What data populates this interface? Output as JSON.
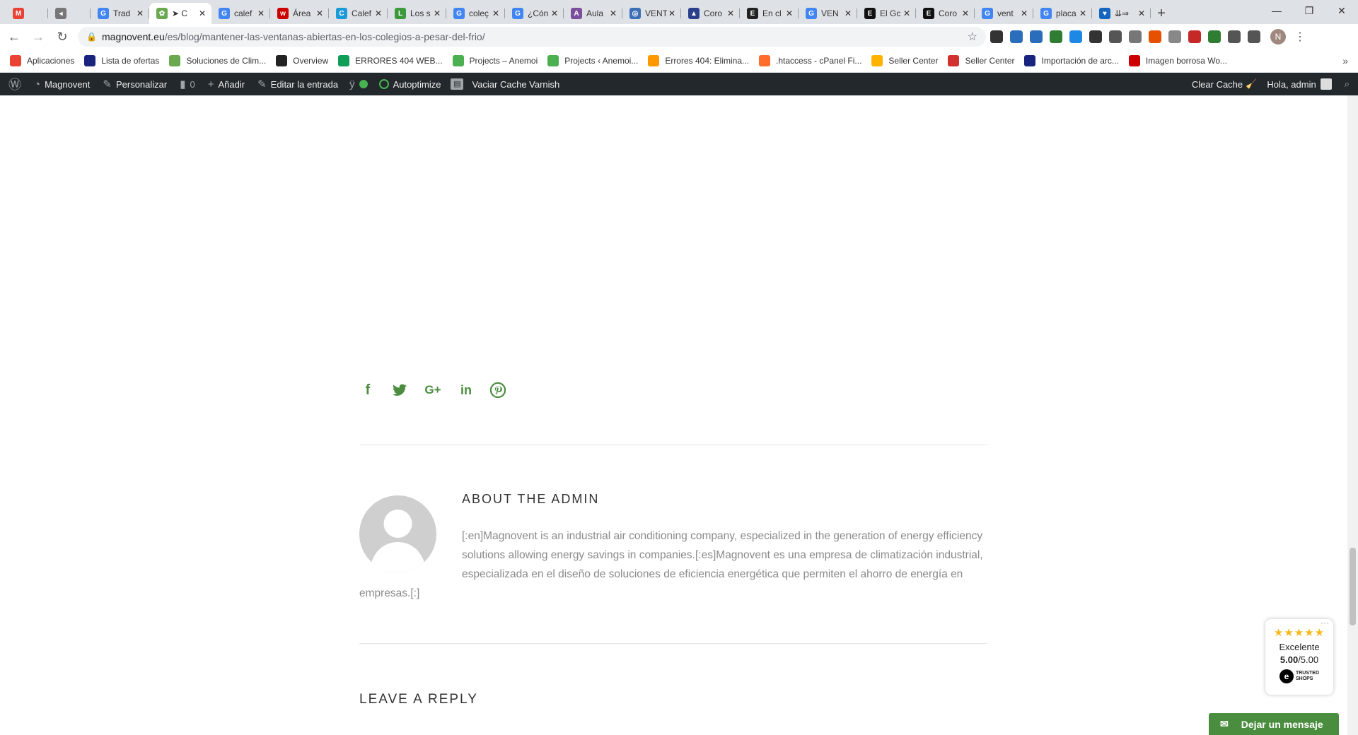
{
  "browser": {
    "tabs": [
      {
        "title": "",
        "icon": "gmail-icon",
        "color": "#ea4335",
        "letter": "M"
      },
      {
        "title": "",
        "icon": "audio-icon",
        "color": "#777777",
        "letter": "◂"
      },
      {
        "title": "Trad",
        "icon": "translate-icon",
        "color": "#4285f4",
        "letter": "G"
      },
      {
        "title": "➤ C",
        "icon": "magnovent-leaf-icon",
        "color": "#6aa84f",
        "letter": "✿",
        "active": true
      },
      {
        "title": "calef",
        "icon": "google-icon",
        "color": "#4285f4",
        "letter": "G"
      },
      {
        "title": "Área",
        "icon": "brand-w-icon",
        "color": "#cc0000",
        "letter": "w"
      },
      {
        "title": "Calef",
        "icon": "brand-c-icon",
        "color": "#1a9bd7",
        "letter": "C"
      },
      {
        "title": "Los s",
        "icon": "leaf-icon",
        "color": "#3c9a3c",
        "letter": "L"
      },
      {
        "title": "coleç",
        "icon": "google-icon",
        "color": "#4285f4",
        "letter": "G"
      },
      {
        "title": "¿Cón",
        "icon": "google-icon",
        "color": "#4285f4",
        "letter": "G"
      },
      {
        "title": "Aula",
        "icon": "aula-icon",
        "color": "#7b4f9d",
        "letter": "A"
      },
      {
        "title": "VENT",
        "icon": "globe-icon",
        "color": "#3b6fb6",
        "letter": "◎"
      },
      {
        "title": "Coro",
        "icon": "antena3-icon",
        "color": "#2b3f8c",
        "letter": "▲"
      },
      {
        "title": "En cl",
        "icon": "brand-dark-icon",
        "color": "#222222",
        "letter": "E"
      },
      {
        "title": "VEN",
        "icon": "google-icon",
        "color": "#4285f4",
        "letter": "G"
      },
      {
        "title": "El Gc",
        "icon": "brand-e-icon",
        "color": "#111111",
        "letter": "E"
      },
      {
        "title": "Coro",
        "icon": "brand-e-icon",
        "color": "#111111",
        "letter": "E"
      },
      {
        "title": "vent",
        "icon": "google-icon",
        "color": "#4285f4",
        "letter": "G"
      },
      {
        "title": "placa",
        "icon": "google-icon",
        "color": "#4285f4",
        "letter": "G"
      },
      {
        "title": "⇊⇒",
        "icon": "shield-icon",
        "color": "#1565c0",
        "letter": "♥"
      }
    ],
    "url_host": "magnovent.eu",
    "url_path": "/es/blog/mantener-las-ventanas-abiertas-en-los-colegios-a-pesar-del-frio/",
    "profile_initial": "N",
    "extension_colors": [
      "#333333",
      "#2a6ebb",
      "#2a6ebb",
      "#2e7d32",
      "#1e88e5",
      "#333333",
      "#555555",
      "#777777",
      "#e65100",
      "#888888",
      "#c62828",
      "#2e7d32",
      "#555555",
      "#555555"
    ]
  },
  "bookmarks": [
    {
      "label": "Aplicaciones",
      "icon": "apps-grid-icon",
      "color": "#ea4335"
    },
    {
      "label": "Lista de ofertas",
      "icon": "shield-icon",
      "color": "#1a237e"
    },
    {
      "label": "Soluciones de Clim...",
      "icon": "leaf-icon",
      "color": "#6aa84f"
    },
    {
      "label": "Overview",
      "icon": "app-dark-icon",
      "color": "#222222"
    },
    {
      "label": "ERRORES 404 WEB...",
      "icon": "sheets-icon",
      "color": "#0f9d58"
    },
    {
      "label": "Projects – Anemoi",
      "icon": "refresh-green-icon",
      "color": "#4caf50"
    },
    {
      "label": "Projects ‹ Anemoi...",
      "icon": "refresh-green-icon",
      "color": "#4caf50"
    },
    {
      "label": "Errores 404: Elimina...",
      "icon": "person-icon",
      "color": "#ff9800"
    },
    {
      "label": ".htaccess - cPanel Fi...",
      "icon": "cpanel-icon",
      "color": "#ff6c2c"
    },
    {
      "label": "Seller Center",
      "icon": "seller-icon",
      "color": "#ffb300"
    },
    {
      "label": "Seller Center",
      "icon": "seller-icon",
      "color": "#d32f2f"
    },
    {
      "label": "Importación de arc...",
      "icon": "shield-icon",
      "color": "#1a237e"
    },
    {
      "label": "Imagen borrosa Wo...",
      "icon": "brand-w-icon",
      "color": "#cc0000"
    }
  ],
  "adminbar": {
    "site": "Magnovent",
    "customize": "Personalizar",
    "comments": "0",
    "add": "Añadir",
    "edit": "Editar la entrada",
    "autoptimize": "Autoptimize",
    "varnish": "Vaciar Cache Varnish",
    "clear_cache": "Clear Cache",
    "greeting": "Hola, admin"
  },
  "about": {
    "title": "ABOUT THE ADMIN",
    "text": "[:en]Magnovent is an industrial air conditioning company, especialized in the generation of energy efficiency solutions allowing energy savings in companies.[:es]Magnovent es una empresa de climatización industrial, especializada en el diseño de soluciones de eficiencia energética que permiten el ahorro de energía en empresas.[:]"
  },
  "reply": {
    "title": "LEAVE A REPLY"
  },
  "trusted": {
    "stars": "★★★★★",
    "rating_word": "Excelente",
    "score": "5.00",
    "max": "/5.00",
    "logo_text_1": "TRUSTED",
    "logo_text_2": "SHOPS"
  },
  "message_button": "Dejar un mensaje",
  "colors": {
    "accent_green": "#4a8d3e",
    "admin_bar": "#23282d"
  }
}
